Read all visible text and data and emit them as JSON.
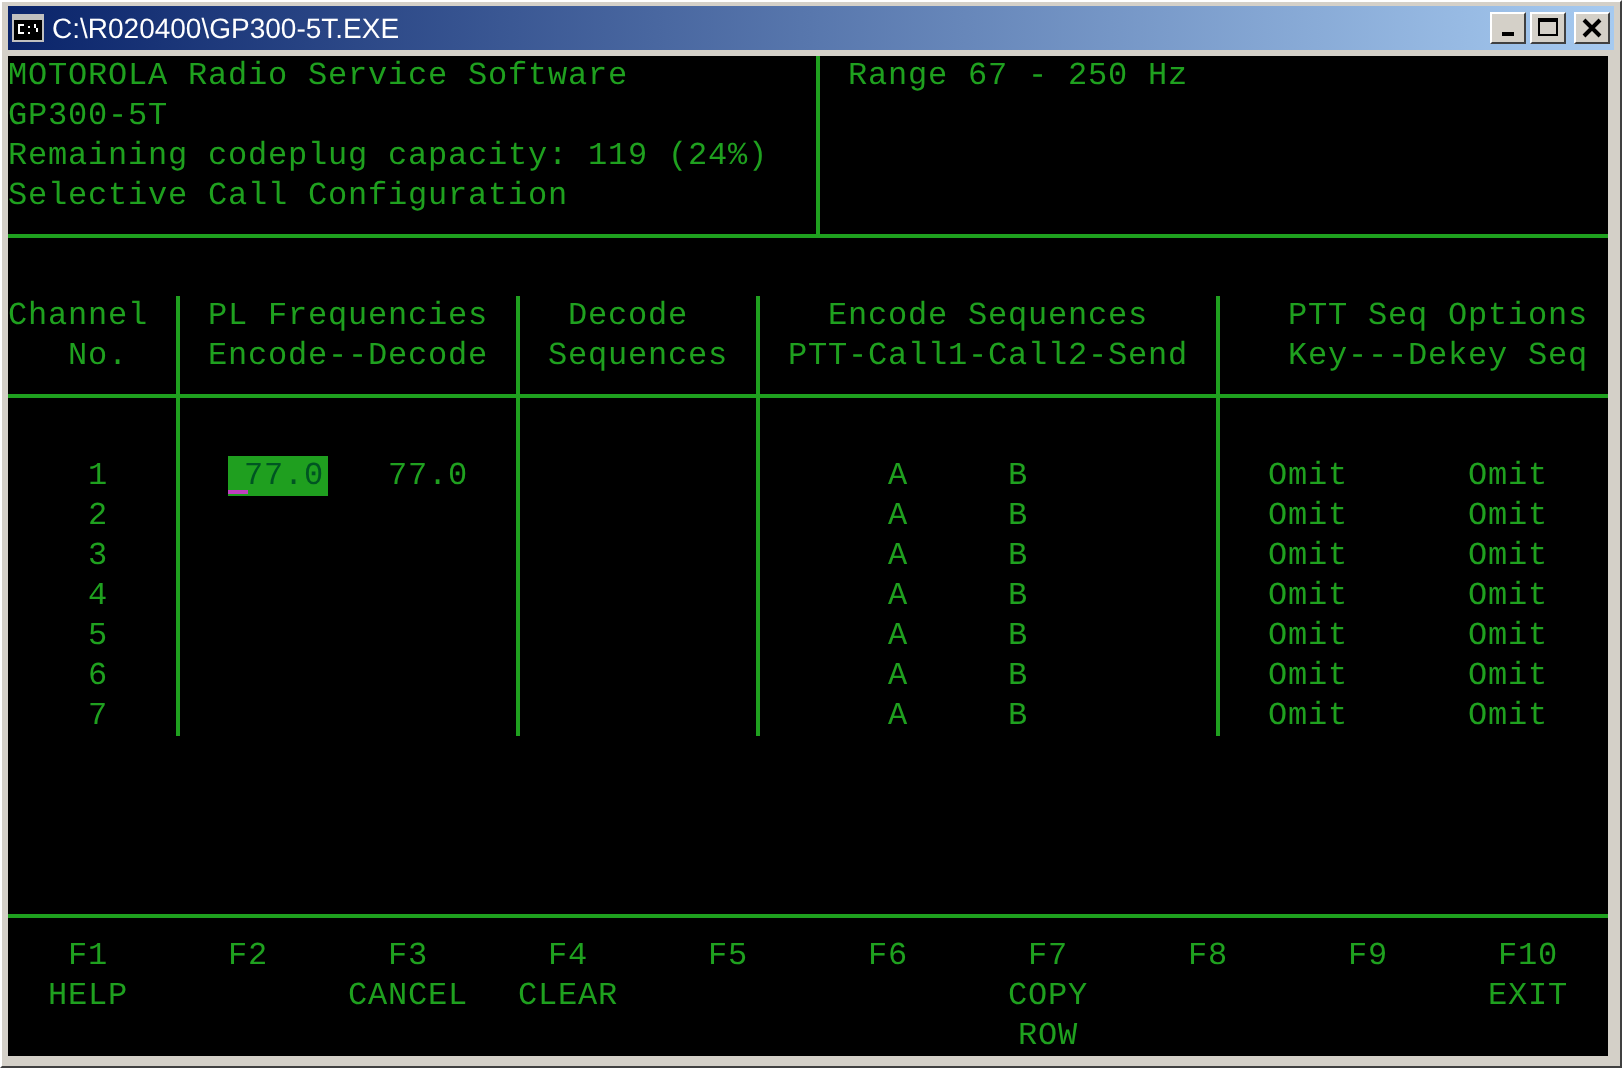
{
  "window": {
    "title": "C:\\R020400\\GP300-5T.EXE"
  },
  "header": {
    "lines": [
      "MOTOROLA Radio Service Software",
      "GP300-5T",
      "Remaining codeplug capacity: 119 (24%)",
      "Selective Call Configuration"
    ],
    "range": "Range 67 - 250 Hz"
  },
  "table": {
    "columns": [
      {
        "line1": "Channel",
        "line2": "No."
      },
      {
        "line1": "PL Frequencies",
        "line2": "Encode--Decode"
      },
      {
        "line1": "Decode",
        "line2": "Sequences"
      },
      {
        "line1": "Encode Sequences",
        "line2": "PTT-Call1-Call2-Send"
      },
      {
        "line1": "PTT Seq Options",
        "line2": "Key---Dekey Seq"
      }
    ],
    "rows": [
      {
        "channel": "1",
        "encode": {
          "value": "77.0",
          "selected": true
        },
        "decode": "77.0",
        "call1": "A",
        "call2": "B",
        "key": "Omit",
        "dekey": "Omit"
      },
      {
        "channel": "2",
        "call1": "A",
        "call2": "B",
        "key": "Omit",
        "dekey": "Omit"
      },
      {
        "channel": "3",
        "call1": "A",
        "call2": "B",
        "key": "Omit",
        "dekey": "Omit"
      },
      {
        "channel": "4",
        "call1": "A",
        "call2": "B",
        "key": "Omit",
        "dekey": "Omit"
      },
      {
        "channel": "5",
        "call1": "A",
        "call2": "B",
        "key": "Omit",
        "dekey": "Omit"
      },
      {
        "channel": "6",
        "call1": "A",
        "call2": "B",
        "key": "Omit",
        "dekey": "Omit"
      },
      {
        "channel": "7",
        "call1": "A",
        "call2": "B",
        "key": "Omit",
        "dekey": "Omit"
      }
    ]
  },
  "function_keys": [
    {
      "key": "F1",
      "label": "HELP"
    },
    {
      "key": "F2"
    },
    {
      "key": "F3",
      "label": "CANCEL"
    },
    {
      "key": "F4",
      "label": "CLEAR"
    },
    {
      "key": "F5"
    },
    {
      "key": "F6"
    },
    {
      "key": "F7",
      "label": "COPY\nROW"
    },
    {
      "key": "F8"
    },
    {
      "key": "F9"
    },
    {
      "key": "F10",
      "label": "EXIT"
    }
  ]
}
